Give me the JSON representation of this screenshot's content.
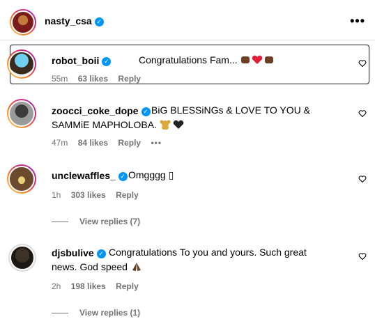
{
  "header": {
    "username": "nasty_csa",
    "more_icon": "more-horizontal-icon"
  },
  "comments": [
    {
      "username": "robot_boii",
      "text": "Congratulations Fam...",
      "emojis": "fist-heart-fist",
      "time": "55m",
      "likes": "63 likes",
      "reply": "Reply",
      "highlighted": true
    },
    {
      "username": "zoocci_coke_dope",
      "text_line1": "BiG BLESSiNGs & LOVE TO YOU &",
      "text_line2": "SAMMiE MAPHOLOBA.",
      "emojis": "teddy-bear-black-heart",
      "time": "47m",
      "likes": "84 likes",
      "reply": "Reply",
      "more": "•••"
    },
    {
      "username": "unclewaffles_",
      "text": "Omgggg ▯",
      "time": "1h",
      "likes": "303 likes",
      "reply": "Reply",
      "view_replies": "View replies (7)"
    },
    {
      "username": "djsbulive",
      "text_line1": "Congratulations To you and yours. Such great",
      "text_line2": "news. God speed",
      "emojis": "folded-hands",
      "time": "2h",
      "likes": "198 likes",
      "reply": "Reply",
      "view_replies": "View replies (1)"
    }
  ],
  "colors": {
    "verified": "#0095f6",
    "secondary_text": "#737373",
    "divider": "#dbdbdb"
  }
}
